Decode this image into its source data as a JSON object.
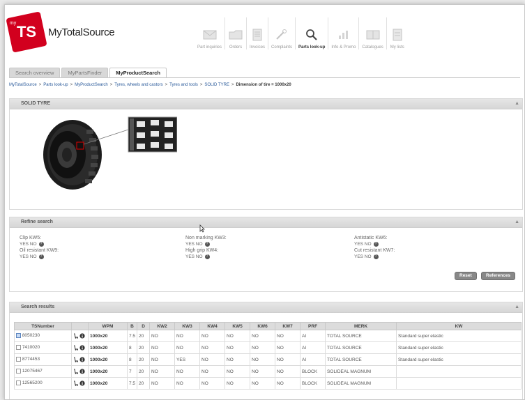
{
  "logo": {
    "badge_small": "my",
    "badge": "TS",
    "text_my": "My",
    "text_brand": "TotalSource"
  },
  "nav": [
    {
      "label": "Part inquiries",
      "icon": "envelope-icon"
    },
    {
      "label": "Orders",
      "icon": "folder-icon"
    },
    {
      "label": "Invoices",
      "icon": "document-icon"
    },
    {
      "label": "Complaints",
      "icon": "tools-icon"
    },
    {
      "label": "Parts look-up",
      "icon": "magnifier-icon",
      "active": true
    },
    {
      "label": "Info & Promo",
      "icon": "bar-chart-icon"
    },
    {
      "label": "Catalogues",
      "icon": "catalogue-icon"
    },
    {
      "label": "My lists",
      "icon": "list-icon"
    }
  ],
  "tabs": [
    "Search overview",
    "MyPartsFinder",
    "MyProductSearch"
  ],
  "breadcrumb": [
    "MyTotalSource",
    "Parts look-up",
    "MyProductSearch",
    "Tyres, wheels and castors",
    "Tyres and tools",
    "SOLID TYRE"
  ],
  "breadcrumb_current": "Dimension of tire = 1000x20",
  "solid_panel": {
    "title": "SOLID TYRE"
  },
  "refine": {
    "title": "Refine search",
    "col1": [
      {
        "label": "Clip KW5:",
        "opts": "YES NO"
      },
      {
        "label": "Oil resistant KW9:",
        "opts": "YES NO"
      }
    ],
    "col2": [
      {
        "label": "Non marking KW3:",
        "opts": "YES NO"
      },
      {
        "label": "High grip KW4:",
        "opts": "YES NO"
      }
    ],
    "col3": [
      {
        "label": "Antistatic KW6:",
        "opts": "YES NO"
      },
      {
        "label": "Cut resistant KW7:",
        "opts": "YES NO"
      }
    ],
    "btn_reset": "Reset",
    "btn_references": "References"
  },
  "results": {
    "title": "Search results",
    "headers": [
      "TSNumber",
      "",
      "WPM",
      "B",
      "D",
      "KW2",
      "KW3",
      "KW4",
      "KW5",
      "KW6",
      "KW7",
      "PRF",
      "MERK",
      "KW"
    ],
    "rows": [
      [
        "8050230",
        "",
        "1000x20",
        "7.5",
        "20",
        "NO",
        "NO",
        "NO",
        "NO",
        "NO",
        "NO",
        "AI",
        "TOTAL SOURCE",
        "Standard super elastic"
      ],
      [
        "7410020",
        "",
        "1000x20",
        "8",
        "20",
        "NO",
        "NO",
        "NO",
        "NO",
        "NO",
        "NO",
        "AI",
        "TOTAL SOURCE",
        "Standard super elastic"
      ],
      [
        "8774453",
        "",
        "1000x20",
        "8",
        "20",
        "NO",
        "YES",
        "NO",
        "NO",
        "NO",
        "NO",
        "AI",
        "TOTAL SOURCE",
        "Standard super elastic"
      ],
      [
        "12075467",
        "",
        "1000x20",
        "7",
        "20",
        "NO",
        "NO",
        "NO",
        "NO",
        "NO",
        "NO",
        "BLOCK",
        "SOLIDEAL MAGNUM",
        ""
      ],
      [
        "12565200",
        "",
        "1000x20",
        "7.5",
        "20",
        "NO",
        "NO",
        "NO",
        "NO",
        "NO",
        "NO",
        "BLOCK",
        "SOLIDEAL MAGNUM",
        ""
      ]
    ]
  },
  "colors": {
    "brand_red": "#d2001e",
    "link_blue": "#2a5a9a",
    "panel_head": "#dcdcdc"
  }
}
